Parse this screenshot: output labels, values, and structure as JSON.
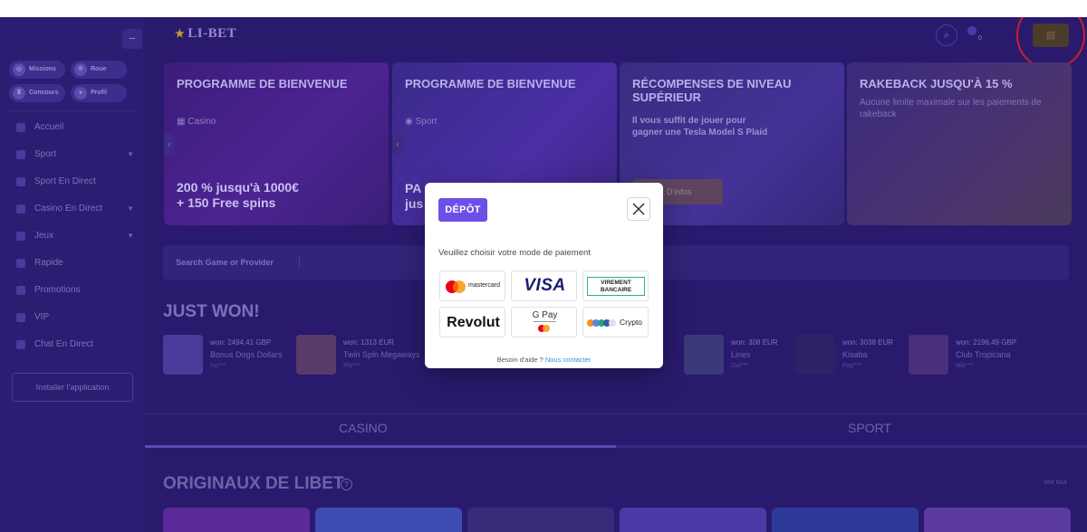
{
  "header": {
    "logo": "LI-BET",
    "balance": "0"
  },
  "sidebar": {
    "quick": [
      {
        "label": "Missions",
        "icon": "target-icon"
      },
      {
        "label": "Roue",
        "icon": "wheel-icon"
      },
      {
        "label": "Concours",
        "icon": "trophy-icon"
      },
      {
        "label": "Profil",
        "icon": "user-icon"
      }
    ],
    "items": [
      {
        "label": "Accueil"
      },
      {
        "label": "Sport"
      },
      {
        "label": "Sport En Direct"
      },
      {
        "label": "Casino En Direct"
      },
      {
        "label": "Jeux"
      },
      {
        "label": "Rapide"
      },
      {
        "label": "Promotions"
      },
      {
        "label": "VIP"
      },
      {
        "label": "Chat En Direct"
      }
    ],
    "install_label": "Installer l'application"
  },
  "promos": [
    {
      "title": "PROGRAMME DE BIENVENUE",
      "sub": "Casino",
      "big1": "200 % jusqu'à 1000€",
      "big2": "+ 150 Free spins"
    },
    {
      "title": "PROGRAMME DE BIENVENUE",
      "sub": "Sport",
      "big1": "PA",
      "big2": "jus"
    },
    {
      "title": "RÉCOMPENSES DE NIVEAU SUPÉRIEUR",
      "text": "Il vous suffit de jouer pour gagner une Tesla Model S Plaid",
      "button": "D'infos"
    },
    {
      "title": "RAKEBACK JUSQU'À 15 %",
      "text": "Aucune limite maximale sur les paiements de rakeback"
    }
  ],
  "search": {
    "placeholder": "Search Game or Provider"
  },
  "just_won": {
    "title": "JUST WON!",
    "items": [
      {
        "amount": "won: 2494.41 GBP",
        "game": "Bonus Dogs Dollars",
        "user": "Inc***"
      },
      {
        "amount": "won: 1313 EUR",
        "game": "Twin Spin Megaways",
        "user": "Pla***"
      },
      {
        "amount": "won: 308 EUR",
        "game": "Lines",
        "user": "Gui***"
      },
      {
        "amount": "won: 3038 EUR",
        "game": "Kisaba",
        "user": "Pap***"
      },
      {
        "amount": "won: 2196.49 GBP",
        "game": "Club Tropicana",
        "user": "Mik***"
      }
    ]
  },
  "tabs": {
    "casino": "CASINO",
    "sport": "SPORT"
  },
  "originals": {
    "title": "ORIGINAUX DE LIBET",
    "see_all": "Voir tout"
  },
  "modal": {
    "tag": "DÉPÔT",
    "prompt": "Veuillez choisir votre mode de paiement",
    "methods": {
      "mastercard": "mastercard",
      "visa": "VISA",
      "virement_1": "VIREMENT",
      "virement_2": "BANCAIRE",
      "revolut": "Revolut",
      "gpay": "G Pay",
      "crypto": "Crypto"
    },
    "help_text": "Besoin d'aide ?",
    "help_link": "Nous contacter"
  },
  "colors": {
    "accent": "#6e4ee8",
    "overlay_bg": "#2a1a6e",
    "highlight_ring": "#cc1f2a"
  }
}
